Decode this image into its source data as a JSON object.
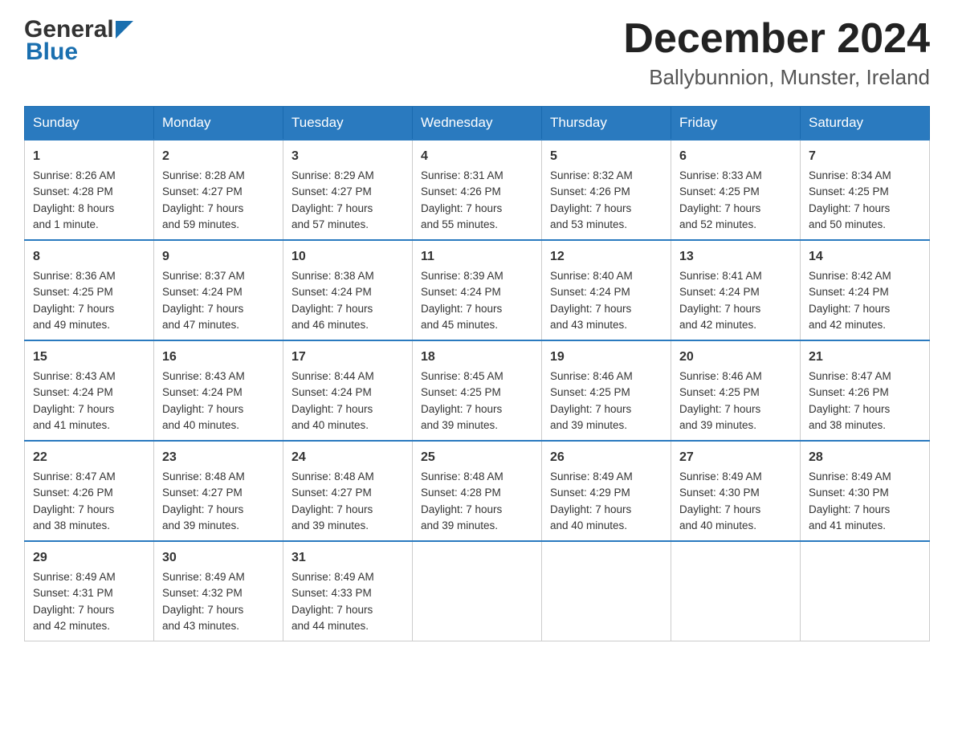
{
  "header": {
    "logo_general": "General",
    "logo_blue": "Blue",
    "month_title": "December 2024",
    "location": "Ballybunnion, Munster, Ireland"
  },
  "days_of_week": [
    "Sunday",
    "Monday",
    "Tuesday",
    "Wednesday",
    "Thursday",
    "Friday",
    "Saturday"
  ],
  "weeks": [
    [
      {
        "day": "1",
        "sunrise": "8:26 AM",
        "sunset": "4:28 PM",
        "daylight": "8 hours and 1 minute."
      },
      {
        "day": "2",
        "sunrise": "8:28 AM",
        "sunset": "4:27 PM",
        "daylight": "7 hours and 59 minutes."
      },
      {
        "day": "3",
        "sunrise": "8:29 AM",
        "sunset": "4:27 PM",
        "daylight": "7 hours and 57 minutes."
      },
      {
        "day": "4",
        "sunrise": "8:31 AM",
        "sunset": "4:26 PM",
        "daylight": "7 hours and 55 minutes."
      },
      {
        "day": "5",
        "sunrise": "8:32 AM",
        "sunset": "4:26 PM",
        "daylight": "7 hours and 53 minutes."
      },
      {
        "day": "6",
        "sunrise": "8:33 AM",
        "sunset": "4:25 PM",
        "daylight": "7 hours and 52 minutes."
      },
      {
        "day": "7",
        "sunrise": "8:34 AM",
        "sunset": "4:25 PM",
        "daylight": "7 hours and 50 minutes."
      }
    ],
    [
      {
        "day": "8",
        "sunrise": "8:36 AM",
        "sunset": "4:25 PM",
        "daylight": "7 hours and 49 minutes."
      },
      {
        "day": "9",
        "sunrise": "8:37 AM",
        "sunset": "4:24 PM",
        "daylight": "7 hours and 47 minutes."
      },
      {
        "day": "10",
        "sunrise": "8:38 AM",
        "sunset": "4:24 PM",
        "daylight": "7 hours and 46 minutes."
      },
      {
        "day": "11",
        "sunrise": "8:39 AM",
        "sunset": "4:24 PM",
        "daylight": "7 hours and 45 minutes."
      },
      {
        "day": "12",
        "sunrise": "8:40 AM",
        "sunset": "4:24 PM",
        "daylight": "7 hours and 43 minutes."
      },
      {
        "day": "13",
        "sunrise": "8:41 AM",
        "sunset": "4:24 PM",
        "daylight": "7 hours and 42 minutes."
      },
      {
        "day": "14",
        "sunrise": "8:42 AM",
        "sunset": "4:24 PM",
        "daylight": "7 hours and 42 minutes."
      }
    ],
    [
      {
        "day": "15",
        "sunrise": "8:43 AM",
        "sunset": "4:24 PM",
        "daylight": "7 hours and 41 minutes."
      },
      {
        "day": "16",
        "sunrise": "8:43 AM",
        "sunset": "4:24 PM",
        "daylight": "7 hours and 40 minutes."
      },
      {
        "day": "17",
        "sunrise": "8:44 AM",
        "sunset": "4:24 PM",
        "daylight": "7 hours and 40 minutes."
      },
      {
        "day": "18",
        "sunrise": "8:45 AM",
        "sunset": "4:25 PM",
        "daylight": "7 hours and 39 minutes."
      },
      {
        "day": "19",
        "sunrise": "8:46 AM",
        "sunset": "4:25 PM",
        "daylight": "7 hours and 39 minutes."
      },
      {
        "day": "20",
        "sunrise": "8:46 AM",
        "sunset": "4:25 PM",
        "daylight": "7 hours and 39 minutes."
      },
      {
        "day": "21",
        "sunrise": "8:47 AM",
        "sunset": "4:26 PM",
        "daylight": "7 hours and 38 minutes."
      }
    ],
    [
      {
        "day": "22",
        "sunrise": "8:47 AM",
        "sunset": "4:26 PM",
        "daylight": "7 hours and 38 minutes."
      },
      {
        "day": "23",
        "sunrise": "8:48 AM",
        "sunset": "4:27 PM",
        "daylight": "7 hours and 39 minutes."
      },
      {
        "day": "24",
        "sunrise": "8:48 AM",
        "sunset": "4:27 PM",
        "daylight": "7 hours and 39 minutes."
      },
      {
        "day": "25",
        "sunrise": "8:48 AM",
        "sunset": "4:28 PM",
        "daylight": "7 hours and 39 minutes."
      },
      {
        "day": "26",
        "sunrise": "8:49 AM",
        "sunset": "4:29 PM",
        "daylight": "7 hours and 40 minutes."
      },
      {
        "day": "27",
        "sunrise": "8:49 AM",
        "sunset": "4:30 PM",
        "daylight": "7 hours and 40 minutes."
      },
      {
        "day": "28",
        "sunrise": "8:49 AM",
        "sunset": "4:30 PM",
        "daylight": "7 hours and 41 minutes."
      }
    ],
    [
      {
        "day": "29",
        "sunrise": "8:49 AM",
        "sunset": "4:31 PM",
        "daylight": "7 hours and 42 minutes."
      },
      {
        "day": "30",
        "sunrise": "8:49 AM",
        "sunset": "4:32 PM",
        "daylight": "7 hours and 43 minutes."
      },
      {
        "day": "31",
        "sunrise": "8:49 AM",
        "sunset": "4:33 PM",
        "daylight": "7 hours and 44 minutes."
      },
      null,
      null,
      null,
      null
    ]
  ]
}
